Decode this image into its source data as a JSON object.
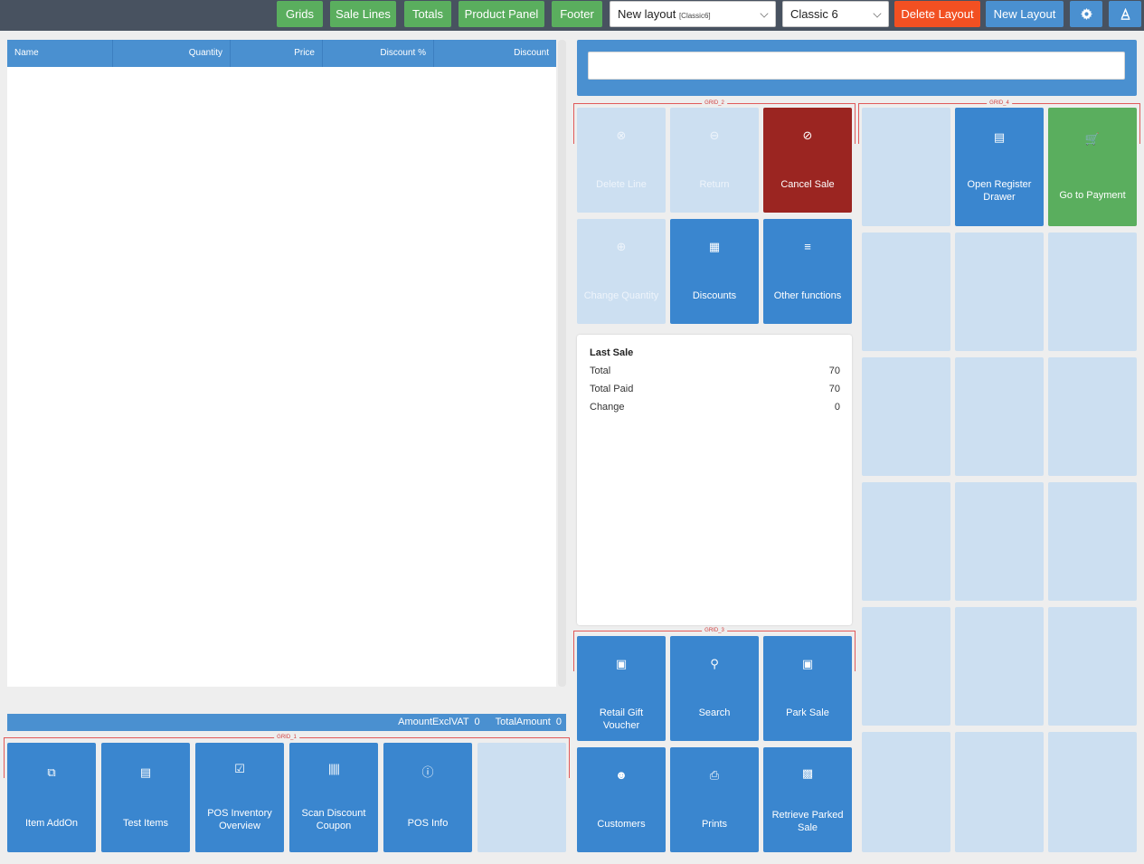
{
  "toolbar": {
    "grids": "Grids",
    "sale_lines": "Sale Lines",
    "totals": "Totals",
    "product_panel": "Product Panel",
    "footer": "Footer",
    "layout_select": "New layout",
    "layout_select_sub": "[Classic6]",
    "theme_select": "Classic 6",
    "delete_layout": "Delete Layout",
    "new_layout": "New Layout",
    "settings_icon": "gear-icon",
    "clear_icon": "eraser-icon"
  },
  "sale_lines": {
    "columns": [
      "Name",
      "Quantity",
      "Price",
      "Discount %",
      "Discount"
    ],
    "rows": []
  },
  "totals": {
    "amount_excl_vat_label": "AmountExclVAT",
    "amount_excl_vat": "0",
    "total_amount_label": "TotalAmount",
    "total_amount": "0"
  },
  "search": {
    "value": "",
    "placeholder": ""
  },
  "grids": {
    "grid1_label": "GRID_1",
    "grid2_label": "GRID_2",
    "grid3_label": "GRID_3",
    "grid4_label": "GRID_4"
  },
  "grid1": [
    {
      "label": "Item AddOn",
      "icon": "copy-icon"
    },
    {
      "label": "Test Items",
      "icon": "scroll-icon"
    },
    {
      "label": "POS Inventory Overview",
      "icon": "check-square-icon"
    },
    {
      "label": "Scan Discount Coupon",
      "icon": "barcode-icon"
    },
    {
      "label": "POS Info",
      "icon": "info-icon"
    }
  ],
  "grid2": [
    {
      "label": "Delete Line",
      "icon": "remove-circle-icon",
      "state": "disabled"
    },
    {
      "label": "Return",
      "icon": "minus-circle-icon",
      "state": "disabled"
    },
    {
      "label": "Cancel Sale",
      "icon": "ban-icon",
      "state": "danger"
    },
    {
      "label": "Change Quantity",
      "icon": "plus-circle-icon",
      "state": "disabled"
    },
    {
      "label": "Discounts",
      "icon": "calculator-icon",
      "state": "active"
    },
    {
      "label": "Other functions",
      "icon": "menu-icon",
      "state": "active"
    }
  ],
  "grid3": [
    {
      "label": "Retail Gift Voucher",
      "icon": "gift-icon"
    },
    {
      "label": "Search",
      "icon": "search-icon"
    },
    {
      "label": "Park Sale",
      "icon": "save-icon"
    },
    {
      "label": "Customers",
      "icon": "user-cog-icon"
    },
    {
      "label": "Prints",
      "icon": "print-icon"
    },
    {
      "label": "Retrieve Parked Sale",
      "icon": "briefcase-icon"
    }
  ],
  "grid4": [
    {
      "label": "Open Register Drawer",
      "icon": "cash-register-icon"
    },
    {
      "label": "Go to Payment",
      "icon": "cart-icon"
    }
  ],
  "last_sale": {
    "title": "Last Sale",
    "rows": [
      {
        "label": "Total",
        "value": "70"
      },
      {
        "label": "Total Paid",
        "value": "70"
      },
      {
        "label": "Change",
        "value": "0"
      }
    ]
  },
  "colors": {
    "primary": "#3a86cf",
    "header": "#4a90d0",
    "tile_empty": "#ccdff1",
    "danger": "#9b2521",
    "success": "#5aae5e",
    "warning": "#f25022",
    "topbar": "#485260"
  }
}
